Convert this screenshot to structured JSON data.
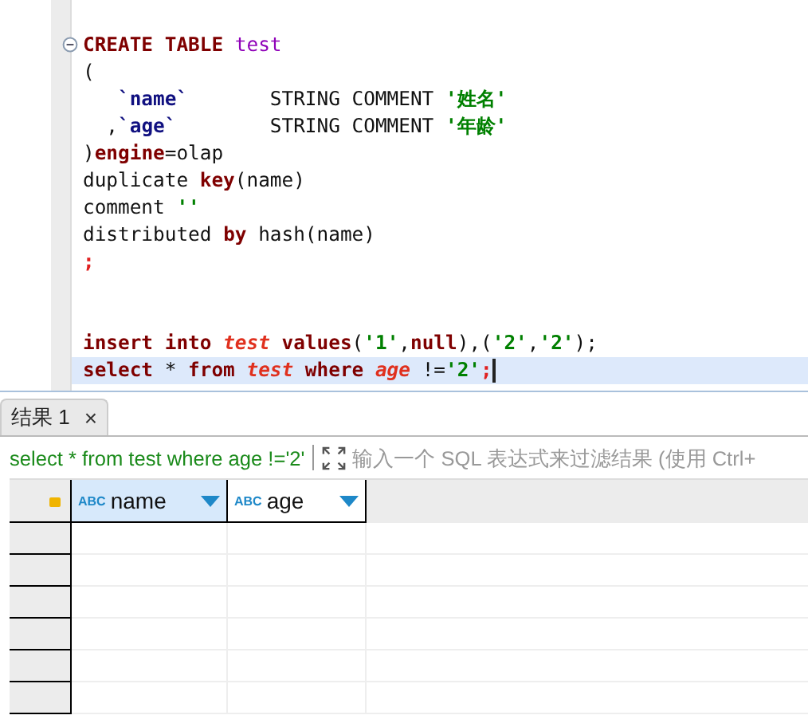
{
  "editor": {
    "statements": [
      [
        {
          "tokens": [
            {
              "kind": "keyword",
              "text": "CREATE TABLE "
            },
            {
              "kind": "table",
              "text": "test"
            }
          ],
          "fold": true,
          "current": false
        },
        {
          "tokens": [
            {
              "kind": "text",
              "text": "("
            }
          ],
          "current": false
        },
        {
          "tokens": [
            {
              "kind": "column",
              "text": "`name`"
            },
            {
              "kind": "text",
              "text": "       STRING COMMENT "
            },
            {
              "kind": "string",
              "text": "'姓名'"
            }
          ],
          "indented": true,
          "current": false
        },
        {
          "tokens": [
            {
              "kind": "text",
              "text": "  ,"
            },
            {
              "kind": "column",
              "text": "`age`"
            },
            {
              "kind": "text",
              "text": "        STRING COMMENT "
            },
            {
              "kind": "string",
              "text": "'年龄'"
            }
          ],
          "current": false
        },
        {
          "tokens": [
            {
              "kind": "text",
              "text": ")"
            },
            {
              "kind": "keyword",
              "text": "engine"
            },
            {
              "kind": "text",
              "text": "=olap"
            }
          ],
          "current": false
        },
        {
          "tokens": [
            {
              "kind": "text",
              "text": "duplicate "
            },
            {
              "kind": "keyword",
              "text": "key"
            },
            {
              "kind": "text",
              "text": "(name)"
            }
          ],
          "current": false
        },
        {
          "tokens": [
            {
              "kind": "text",
              "text": "comment "
            },
            {
              "kind": "string",
              "text": "''"
            }
          ],
          "current": false
        },
        {
          "tokens": [
            {
              "kind": "text",
              "text": "distributed "
            },
            {
              "kind": "keyword",
              "text": "by"
            },
            {
              "kind": "text",
              "text": " hash(name)"
            }
          ],
          "current": false
        },
        {
          "tokens": [
            {
              "kind": "delimiter",
              "text": ";"
            }
          ],
          "current": false
        }
      ],
      [
        {
          "tokens": [
            {
              "kind": "keyword",
              "text": "insert into "
            },
            {
              "kind": "ref",
              "text": "test"
            },
            {
              "kind": "keyword",
              "text": " values"
            },
            {
              "kind": "text",
              "text": "("
            },
            {
              "kind": "string",
              "text": "'1'"
            },
            {
              "kind": "text",
              "text": ","
            },
            {
              "kind": "keyword",
              "text": "null"
            },
            {
              "kind": "text",
              "text": "),("
            },
            {
              "kind": "string",
              "text": "'2'"
            },
            {
              "kind": "text",
              "text": ","
            },
            {
              "kind": "string",
              "text": "'2'"
            },
            {
              "kind": "text",
              "text": ");"
            }
          ],
          "current": false
        },
        {
          "tokens": [
            {
              "kind": "keyword",
              "text": "select"
            },
            {
              "kind": "text",
              "text": " * "
            },
            {
              "kind": "keyword",
              "text": "from "
            },
            {
              "kind": "ref",
              "text": "test"
            },
            {
              "kind": "keyword",
              "text": " where "
            },
            {
              "kind": "ref",
              "text": "age"
            },
            {
              "kind": "text",
              "text": " !="
            },
            {
              "kind": "string",
              "text": "'2'"
            },
            {
              "kind": "delimiter",
              "text": ";"
            }
          ],
          "current": true
        }
      ]
    ]
  },
  "results": {
    "tabs": [
      {
        "label": "结果 1",
        "close": "×",
        "selected": true
      }
    ],
    "query": "select * from test where age !='2'",
    "filter": {
      "placeholder": "输入一个 SQL 表达式来过滤结果 (使用 Ctrl+"
    },
    "columns": [
      {
        "type": "ABC",
        "name": "name",
        "selected": true
      },
      {
        "type": "ABC",
        "name": "age",
        "selected": false
      }
    ]
  }
}
